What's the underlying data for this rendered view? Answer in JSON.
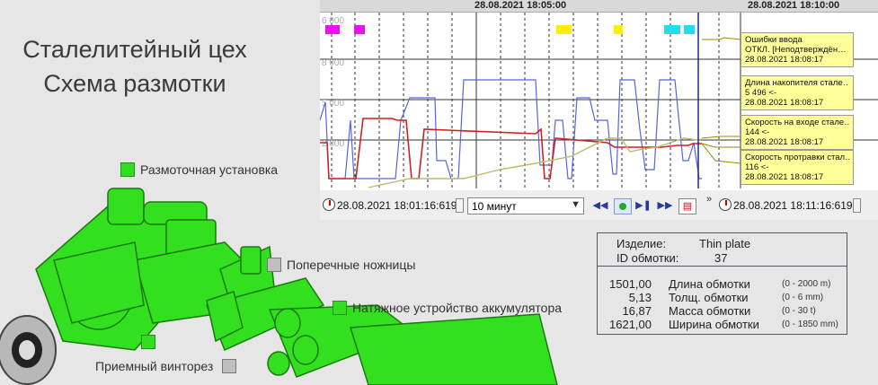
{
  "page": {
    "title_line1": "Сталелитейный цех",
    "title_line2": "Схема размотки"
  },
  "legend": {
    "uncoiler": "Размоточная установка",
    "shears": "Поперечные ножницы",
    "tension": "Натяжное устройство аккумулятора",
    "pinch": "Приемный винторез"
  },
  "trend": {
    "header_left": "28.08.2021 18:05:00",
    "header_right": "28.08.2021 18:10:00",
    "y_ticks": [
      "6 000",
      "8 000",
      "5 000",
      "2 000"
    ],
    "start_time": "28.08.2021 18:01:16:619",
    "end_time": "28.08.2021 18:11:16:619",
    "interval": "10 минут",
    "colors": {
      "red": "#cc2222",
      "blue": "#5566dd",
      "olive": "#bbbb66",
      "magenta": "#ee11ee",
      "yellow": "#ffee00",
      "cyan": "#22ddee"
    },
    "notes": [
      {
        "line1": "Ошибки ввода",
        "line2": "ОТКЛ. [Неподтверждён…",
        "time": "28.08.2021 18:08:17"
      },
      {
        "line1": "Длина накопителя стале…",
        "line2": "5 496 <-",
        "time": "28.08.2021 18:08:17"
      },
      {
        "line1": "Скорость на входе стале…",
        "line2": "144 <-",
        "time": "28.08.2021 18:08:17"
      },
      {
        "line1": "Скорость протравки стал…",
        "line2": "116 <-",
        "time": "28.08.2021 18:08:17"
      }
    ]
  },
  "info": {
    "product_label": "Изделие:",
    "product_value": "Thin plate",
    "coil_id_label": "ID обмотки:",
    "coil_id_value": "37",
    "rows": [
      {
        "value": "1501,00",
        "label": "Длина обмотки",
        "range": "(0 - 2000 m)"
      },
      {
        "value": "5,13",
        "label": "Толщ. обмотки",
        "range": "(0 - 6 mm)"
      },
      {
        "value": "16,87",
        "label": "Масса обмотки",
        "range": "(0 - 30 t)"
      },
      {
        "value": "1621,00",
        "label": "Ширина обмотки",
        "range": "(0 - 1850 mm)"
      }
    ]
  }
}
